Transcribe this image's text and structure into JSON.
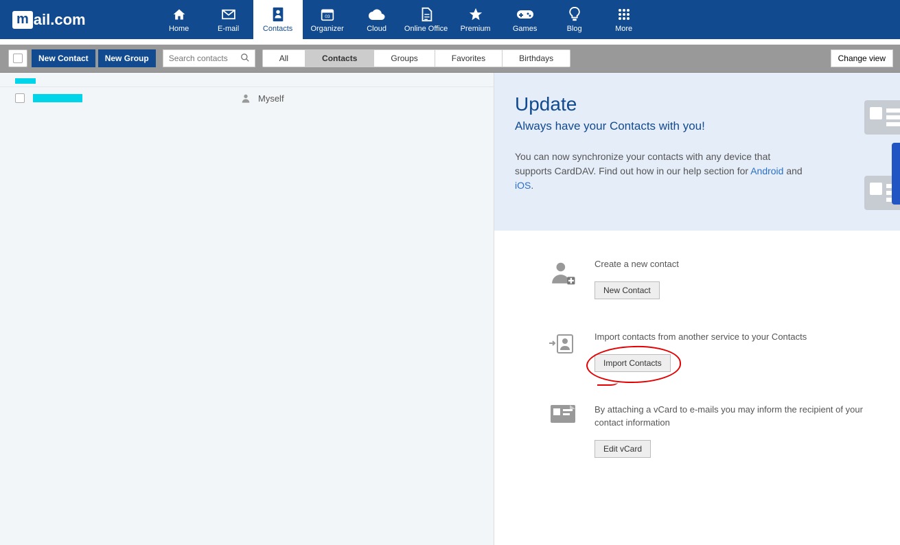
{
  "brand": {
    "prefix": "m",
    "rest": "ail.com"
  },
  "nav": [
    {
      "id": "home",
      "label": "Home"
    },
    {
      "id": "email",
      "label": "E-mail"
    },
    {
      "id": "contacts",
      "label": "Contacts",
      "active": true
    },
    {
      "id": "organizer",
      "label": "Organizer"
    },
    {
      "id": "cloud",
      "label": "Cloud"
    },
    {
      "id": "online-office",
      "label": "Online Office"
    },
    {
      "id": "premium",
      "label": "Premium"
    },
    {
      "id": "games",
      "label": "Games"
    },
    {
      "id": "blog",
      "label": "Blog"
    },
    {
      "id": "more",
      "label": "More"
    }
  ],
  "toolbar": {
    "new_contact": "New Contact",
    "new_group": "New Group",
    "search_placeholder": "Search contacts",
    "change_view": "Change view"
  },
  "filters": {
    "all": "All",
    "contacts": "Contacts",
    "groups": "Groups",
    "favorites": "Favorites",
    "birthdays": "Birthdays"
  },
  "list": {
    "myself_label": "Myself"
  },
  "update_panel": {
    "title": "Update",
    "subtitle": "Always have your Contacts with you!",
    "body_prefix": "You can now synchronize your contacts with any device that supports CardDAV. Find out how in our help section for ",
    "link_android": "Android",
    "body_mid": " and ",
    "link_ios": "iOS",
    "body_suffix": "."
  },
  "actions": {
    "create": {
      "text": "Create a new contact",
      "button": "New Contact"
    },
    "import": {
      "text": "Import contacts from another service to your Contacts",
      "button": "Import Contacts"
    },
    "vcard": {
      "text": "By attaching a vCard to e-mails you may inform the recipient of your contact information",
      "button": "Edit vCard"
    }
  }
}
